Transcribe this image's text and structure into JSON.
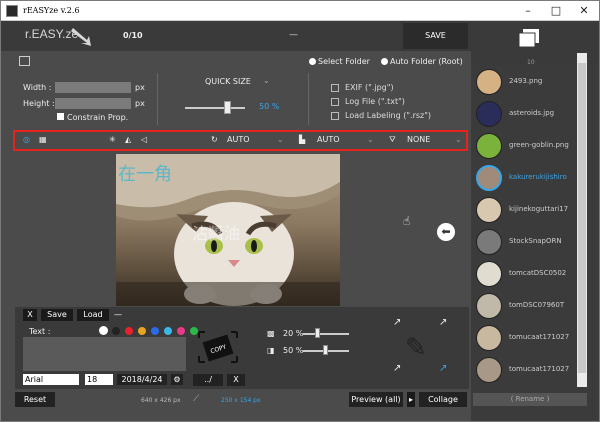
{
  "window": {
    "title": "rEASYze v.2.6"
  },
  "header": {
    "logo": "r.EASY.ze",
    "count": "0/10",
    "status": "—",
    "save_label": "SAVE"
  },
  "folders": {
    "select_label": "Select Folder",
    "auto_label": "Auto Folder (Root)"
  },
  "size": {
    "width_label": "Width :",
    "height_label": "Height :",
    "width_value": "",
    "height_value": "",
    "px": "px",
    "constrain_label": "Constrain Prop."
  },
  "quick": {
    "label": "QUICK SIZE",
    "percent": "50 %",
    "level": 0.65
  },
  "options": {
    "exif": "EXIF (\".jpg\")",
    "logfile": "Log File (\".txt\")",
    "labeling": "Load Labeling (\".rsz\")"
  },
  "toolbar": {
    "rotate_value": "AUTO",
    "save_value": "AUTO",
    "filter_value": "NONE"
  },
  "watermark": {
    "text1": "在一角",
    "text2": "沾醬油"
  },
  "text_panel": {
    "tabs": [
      "X",
      "Save",
      "Load",
      "—"
    ],
    "text_label": "Text :",
    "colors": [
      "#ffffff",
      "#222222",
      "#e8222c",
      "#e8a320",
      "#2a6ae8",
      "#3ab8e8",
      "#e83a8a",
      "#2ab84a"
    ],
    "font": "Arial",
    "font_size": "18",
    "date": "2018/4/24"
  },
  "copy_panel": {
    "stamp": "COPY",
    "path_label": "../",
    "x_label": "X"
  },
  "sliders": {
    "opacity_label": "20 %",
    "opacity": 0.2,
    "scale_label": "50 %",
    "scale": 0.5
  },
  "footer": {
    "reset": "Reset",
    "orig_dims": "640 x 426 px",
    "new_dims": "250 x 154 px",
    "preview": "Preview (all)",
    "collage": "Collage"
  },
  "sidebar": {
    "count": "10",
    "rename": "( Rename )",
    "files": [
      {
        "name": "2493.png",
        "color": "#d6b184"
      },
      {
        "name": "asteroids.jpg",
        "color": "#2a2d5a"
      },
      {
        "name": "green-goblin.png",
        "color": "#7ab23c"
      },
      {
        "name": "kakurerukijishiro",
        "color": "#a08a7a",
        "selected": true
      },
      {
        "name": "kijinekoguttari17",
        "color": "#d8c8b0"
      },
      {
        "name": "StockSnapORN",
        "color": "#7a7a7a"
      },
      {
        "name": "tomcatDSC0502",
        "color": "#e0dcd0"
      },
      {
        "name": "tomDSC07960T",
        "color": "#c0b8a8"
      },
      {
        "name": "tomucaat171027",
        "color": "#c8b8a0"
      },
      {
        "name": "tomucaat171027",
        "color": "#a89888"
      }
    ]
  }
}
